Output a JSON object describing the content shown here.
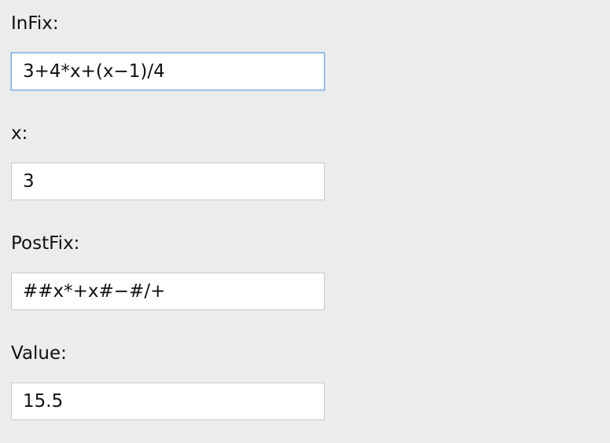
{
  "fields": {
    "infix": {
      "label": "InFix:",
      "value": "3+4*x+(x−1)/4"
    },
    "x": {
      "label": "x:",
      "value": "3"
    },
    "postfix": {
      "label": "PostFix:",
      "value": "##x*+x#−#/+"
    },
    "value": {
      "label": "Value:",
      "value": "15.5"
    }
  }
}
